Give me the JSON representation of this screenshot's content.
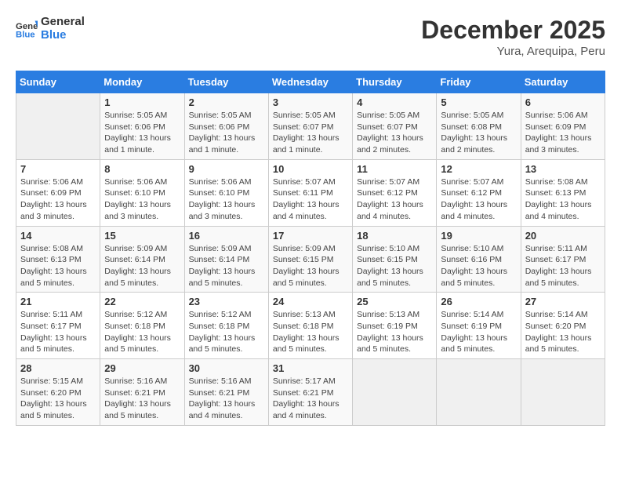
{
  "header": {
    "logo_line1": "General",
    "logo_line2": "Blue",
    "month": "December 2025",
    "location": "Yura, Arequipa, Peru"
  },
  "weekdays": [
    "Sunday",
    "Monday",
    "Tuesday",
    "Wednesday",
    "Thursday",
    "Friday",
    "Saturday"
  ],
  "weeks": [
    [
      {
        "day": "",
        "info": ""
      },
      {
        "day": "1",
        "info": "Sunrise: 5:05 AM\nSunset: 6:06 PM\nDaylight: 13 hours\nand 1 minute."
      },
      {
        "day": "2",
        "info": "Sunrise: 5:05 AM\nSunset: 6:06 PM\nDaylight: 13 hours\nand 1 minute."
      },
      {
        "day": "3",
        "info": "Sunrise: 5:05 AM\nSunset: 6:07 PM\nDaylight: 13 hours\nand 1 minute."
      },
      {
        "day": "4",
        "info": "Sunrise: 5:05 AM\nSunset: 6:07 PM\nDaylight: 13 hours\nand 2 minutes."
      },
      {
        "day": "5",
        "info": "Sunrise: 5:05 AM\nSunset: 6:08 PM\nDaylight: 13 hours\nand 2 minutes."
      },
      {
        "day": "6",
        "info": "Sunrise: 5:06 AM\nSunset: 6:09 PM\nDaylight: 13 hours\nand 3 minutes."
      }
    ],
    [
      {
        "day": "7",
        "info": "Sunrise: 5:06 AM\nSunset: 6:09 PM\nDaylight: 13 hours\nand 3 minutes."
      },
      {
        "day": "8",
        "info": "Sunrise: 5:06 AM\nSunset: 6:10 PM\nDaylight: 13 hours\nand 3 minutes."
      },
      {
        "day": "9",
        "info": "Sunrise: 5:06 AM\nSunset: 6:10 PM\nDaylight: 13 hours\nand 3 minutes."
      },
      {
        "day": "10",
        "info": "Sunrise: 5:07 AM\nSunset: 6:11 PM\nDaylight: 13 hours\nand 4 minutes."
      },
      {
        "day": "11",
        "info": "Sunrise: 5:07 AM\nSunset: 6:12 PM\nDaylight: 13 hours\nand 4 minutes."
      },
      {
        "day": "12",
        "info": "Sunrise: 5:07 AM\nSunset: 6:12 PM\nDaylight: 13 hours\nand 4 minutes."
      },
      {
        "day": "13",
        "info": "Sunrise: 5:08 AM\nSunset: 6:13 PM\nDaylight: 13 hours\nand 4 minutes."
      }
    ],
    [
      {
        "day": "14",
        "info": "Sunrise: 5:08 AM\nSunset: 6:13 PM\nDaylight: 13 hours\nand 5 minutes."
      },
      {
        "day": "15",
        "info": "Sunrise: 5:09 AM\nSunset: 6:14 PM\nDaylight: 13 hours\nand 5 minutes."
      },
      {
        "day": "16",
        "info": "Sunrise: 5:09 AM\nSunset: 6:14 PM\nDaylight: 13 hours\nand 5 minutes."
      },
      {
        "day": "17",
        "info": "Sunrise: 5:09 AM\nSunset: 6:15 PM\nDaylight: 13 hours\nand 5 minutes."
      },
      {
        "day": "18",
        "info": "Sunrise: 5:10 AM\nSunset: 6:15 PM\nDaylight: 13 hours\nand 5 minutes."
      },
      {
        "day": "19",
        "info": "Sunrise: 5:10 AM\nSunset: 6:16 PM\nDaylight: 13 hours\nand 5 minutes."
      },
      {
        "day": "20",
        "info": "Sunrise: 5:11 AM\nSunset: 6:17 PM\nDaylight: 13 hours\nand 5 minutes."
      }
    ],
    [
      {
        "day": "21",
        "info": "Sunrise: 5:11 AM\nSunset: 6:17 PM\nDaylight: 13 hours\nand 5 minutes."
      },
      {
        "day": "22",
        "info": "Sunrise: 5:12 AM\nSunset: 6:18 PM\nDaylight: 13 hours\nand 5 minutes."
      },
      {
        "day": "23",
        "info": "Sunrise: 5:12 AM\nSunset: 6:18 PM\nDaylight: 13 hours\nand 5 minutes."
      },
      {
        "day": "24",
        "info": "Sunrise: 5:13 AM\nSunset: 6:18 PM\nDaylight: 13 hours\nand 5 minutes."
      },
      {
        "day": "25",
        "info": "Sunrise: 5:13 AM\nSunset: 6:19 PM\nDaylight: 13 hours\nand 5 minutes."
      },
      {
        "day": "26",
        "info": "Sunrise: 5:14 AM\nSunset: 6:19 PM\nDaylight: 13 hours\nand 5 minutes."
      },
      {
        "day": "27",
        "info": "Sunrise: 5:14 AM\nSunset: 6:20 PM\nDaylight: 13 hours\nand 5 minutes."
      }
    ],
    [
      {
        "day": "28",
        "info": "Sunrise: 5:15 AM\nSunset: 6:20 PM\nDaylight: 13 hours\nand 5 minutes."
      },
      {
        "day": "29",
        "info": "Sunrise: 5:16 AM\nSunset: 6:21 PM\nDaylight: 13 hours\nand 5 minutes."
      },
      {
        "day": "30",
        "info": "Sunrise: 5:16 AM\nSunset: 6:21 PM\nDaylight: 13 hours\nand 4 minutes."
      },
      {
        "day": "31",
        "info": "Sunrise: 5:17 AM\nSunset: 6:21 PM\nDaylight: 13 hours\nand 4 minutes."
      },
      {
        "day": "",
        "info": ""
      },
      {
        "day": "",
        "info": ""
      },
      {
        "day": "",
        "info": ""
      }
    ]
  ]
}
